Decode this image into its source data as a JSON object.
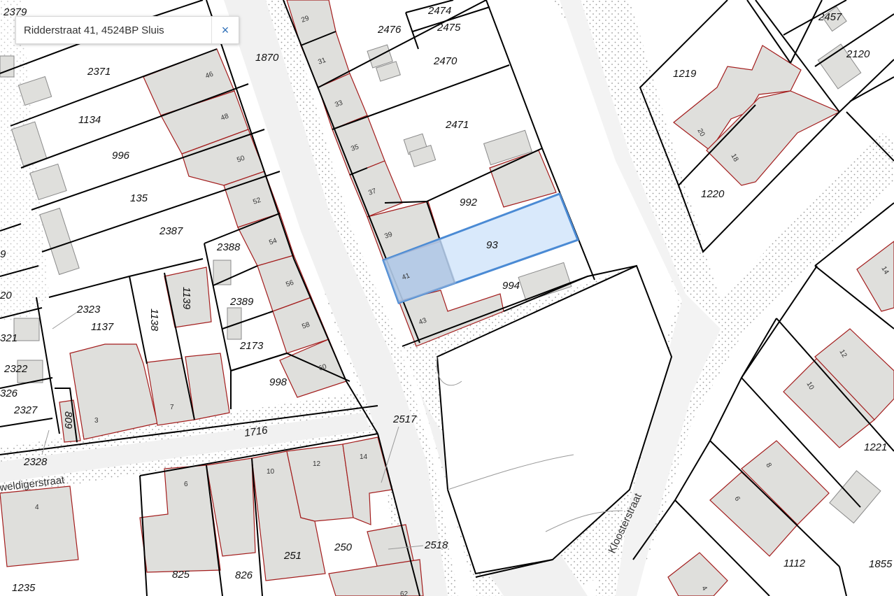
{
  "search": {
    "address": "Ridderstraat 41, 4524BP Sluis",
    "close_symbol": "×"
  },
  "colors": {
    "parcel_line": "#000000",
    "building_fill": "#dfdfdc",
    "building_line": "#a31c1c",
    "selection_fill": "#cfe3fa",
    "selection_line": "#4a8ad4",
    "sidewalk_dots": "#9a9a9a"
  },
  "parcels": {
    "p2379": "2379",
    "p2371": "2371",
    "p1134": "1134",
    "p996": "996",
    "p135": "135",
    "p2387": "2387",
    "p2388": "2388",
    "p2389": "2389",
    "p2173": "2173",
    "p998": "998",
    "p2323": "2323",
    "p1137": "1137",
    "p1138": "1138",
    "p1139": "1139",
    "p321": "321",
    "p20": "20",
    "p9": "9",
    "p2322": "2322",
    "p2327": "2327",
    "p2328": "2328",
    "p326": "326",
    "p809": "809",
    "p1870": "1870",
    "p1716": "1716",
    "p2476": "2476",
    "p2474": "2474",
    "p2475": "2475",
    "p2470": "2470",
    "p2471": "2471",
    "p992": "992",
    "p993": "93",
    "p994": "994",
    "p2517": "2517",
    "p2518": "2518",
    "p250": "250",
    "p251": "251",
    "p825": "825",
    "p826": "826",
    "p1235": "1235",
    "p1219": "1219",
    "p1220": "1220",
    "p2457": "2457",
    "p2120": "2120",
    "p1221": "1221",
    "p1112": "1112",
    "p1855": "1855"
  },
  "house_numbers": {
    "h29": "29",
    "h31": "31",
    "h33": "33",
    "h35": "35",
    "h37": "37",
    "h39": "39",
    "h41": "41",
    "h43": "43",
    "h46": "46",
    "h48": "48",
    "h50": "50",
    "h52": "52",
    "h54": "54",
    "h56": "56",
    "h58": "58",
    "h60": "60",
    "h3": "3",
    "h7": "7",
    "h4": "4",
    "h6": "6",
    "h10": "10",
    "h12": "12",
    "h14": "14",
    "h62": "62",
    "h20": "20",
    "h18": "18",
    "hr12": "12",
    "hr10": "10",
    "hr8": "8",
    "hr6": "6",
    "hr4": "4",
    "hr14": "14"
  },
  "streets": {
    "kloosterstraat": "Kloosterstraat",
    "weldigerstraat": "weldigerstraat"
  }
}
